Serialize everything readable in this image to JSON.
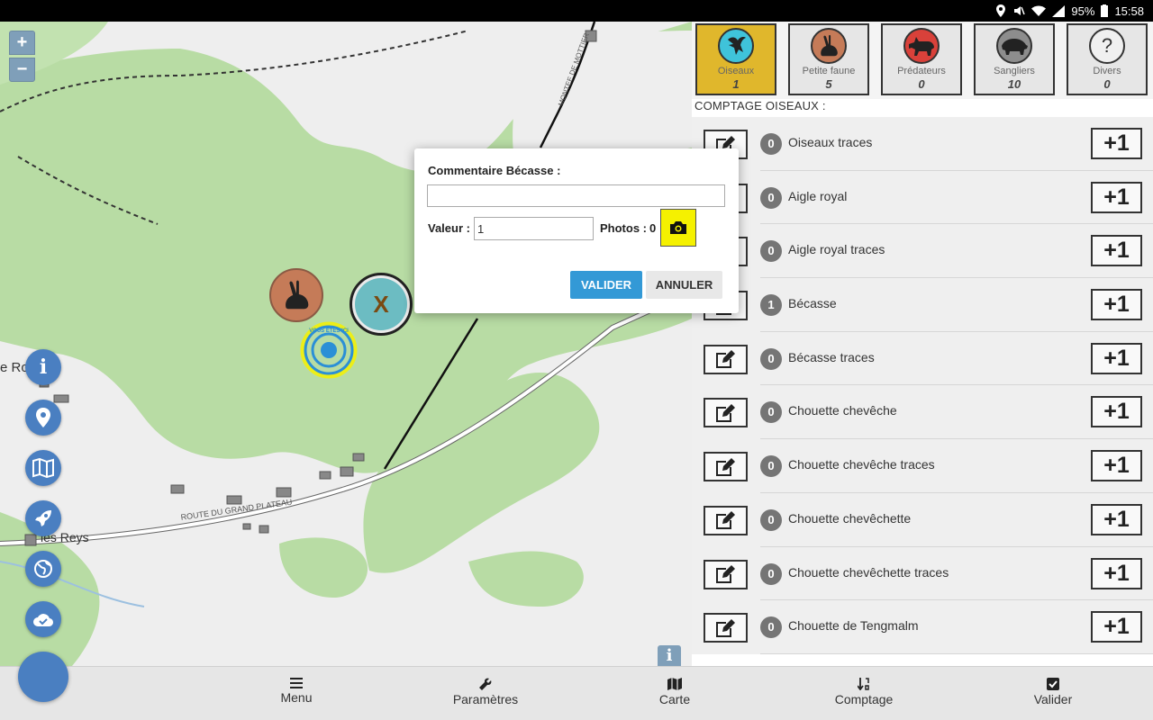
{
  "status_bar": {
    "battery": "95%",
    "time": "15:58"
  },
  "map": {
    "zoom_in": "+",
    "zoom_out": "−",
    "labels": {
      "place_left": "e Ro",
      "place_reys": "les Reys",
      "road_grand_plateau": "ROUTE DU GRAND PLATEAU",
      "road_montee": "MONTEE DE MOTTIER",
      "you_are_here": "VOUS ÊTES ICI"
    },
    "marker_x_label": "X",
    "info_label": "i",
    "attribution_label": "i"
  },
  "categories": [
    {
      "label": "Oiseaux",
      "count": "1",
      "active": true,
      "color": "#3fc3da"
    },
    {
      "label": "Petite faune",
      "count": "5",
      "active": false,
      "color": "#c57b58"
    },
    {
      "label": "Prédateurs",
      "count": "0",
      "active": false,
      "color": "#d9413a"
    },
    {
      "label": "Sangliers",
      "count": "10",
      "active": false,
      "color": "#8d8d8d"
    },
    {
      "label": "Divers",
      "count": "0",
      "active": false,
      "color": "#f0f0f0",
      "symbol": "?"
    }
  ],
  "section_title": "COMPTAGE OISEAUX :",
  "species": [
    {
      "name": "Oiseaux traces",
      "count": "0",
      "plus": "+1"
    },
    {
      "name": "Aigle royal",
      "count": "0",
      "plus": "+1"
    },
    {
      "name": "Aigle royal traces",
      "count": "0",
      "plus": "+1"
    },
    {
      "name": "Bécasse",
      "count": "1",
      "plus": "+1"
    },
    {
      "name": "Bécasse traces",
      "count": "0",
      "plus": "+1"
    },
    {
      "name": "Chouette chevêche",
      "count": "0",
      "plus": "+1"
    },
    {
      "name": "Chouette chevêche traces",
      "count": "0",
      "plus": "+1"
    },
    {
      "name": "Chouette chevêchette",
      "count": "0",
      "plus": "+1"
    },
    {
      "name": "Chouette chevêchette traces",
      "count": "0",
      "plus": "+1"
    },
    {
      "name": "Chouette de Tengmalm",
      "count": "0",
      "plus": "+1"
    }
  ],
  "nav": {
    "menu": "Menu",
    "parametres": "Paramètres",
    "carte": "Carte",
    "comptage": "Comptage",
    "valider": "Valider"
  },
  "dialog": {
    "title": "Commentaire Bécasse :",
    "comment_value": "",
    "valeur_label": "Valeur :",
    "valeur_value": "1",
    "photos_label": "Photos :",
    "photos_count": "0",
    "valider": "VALIDER",
    "annuler": "ANNULER"
  },
  "colors": {
    "accent": "#e0b72c",
    "fab_blue": "#4a7fc1",
    "forest_green": "#b8dca4",
    "primary_button": "#3399d6"
  }
}
